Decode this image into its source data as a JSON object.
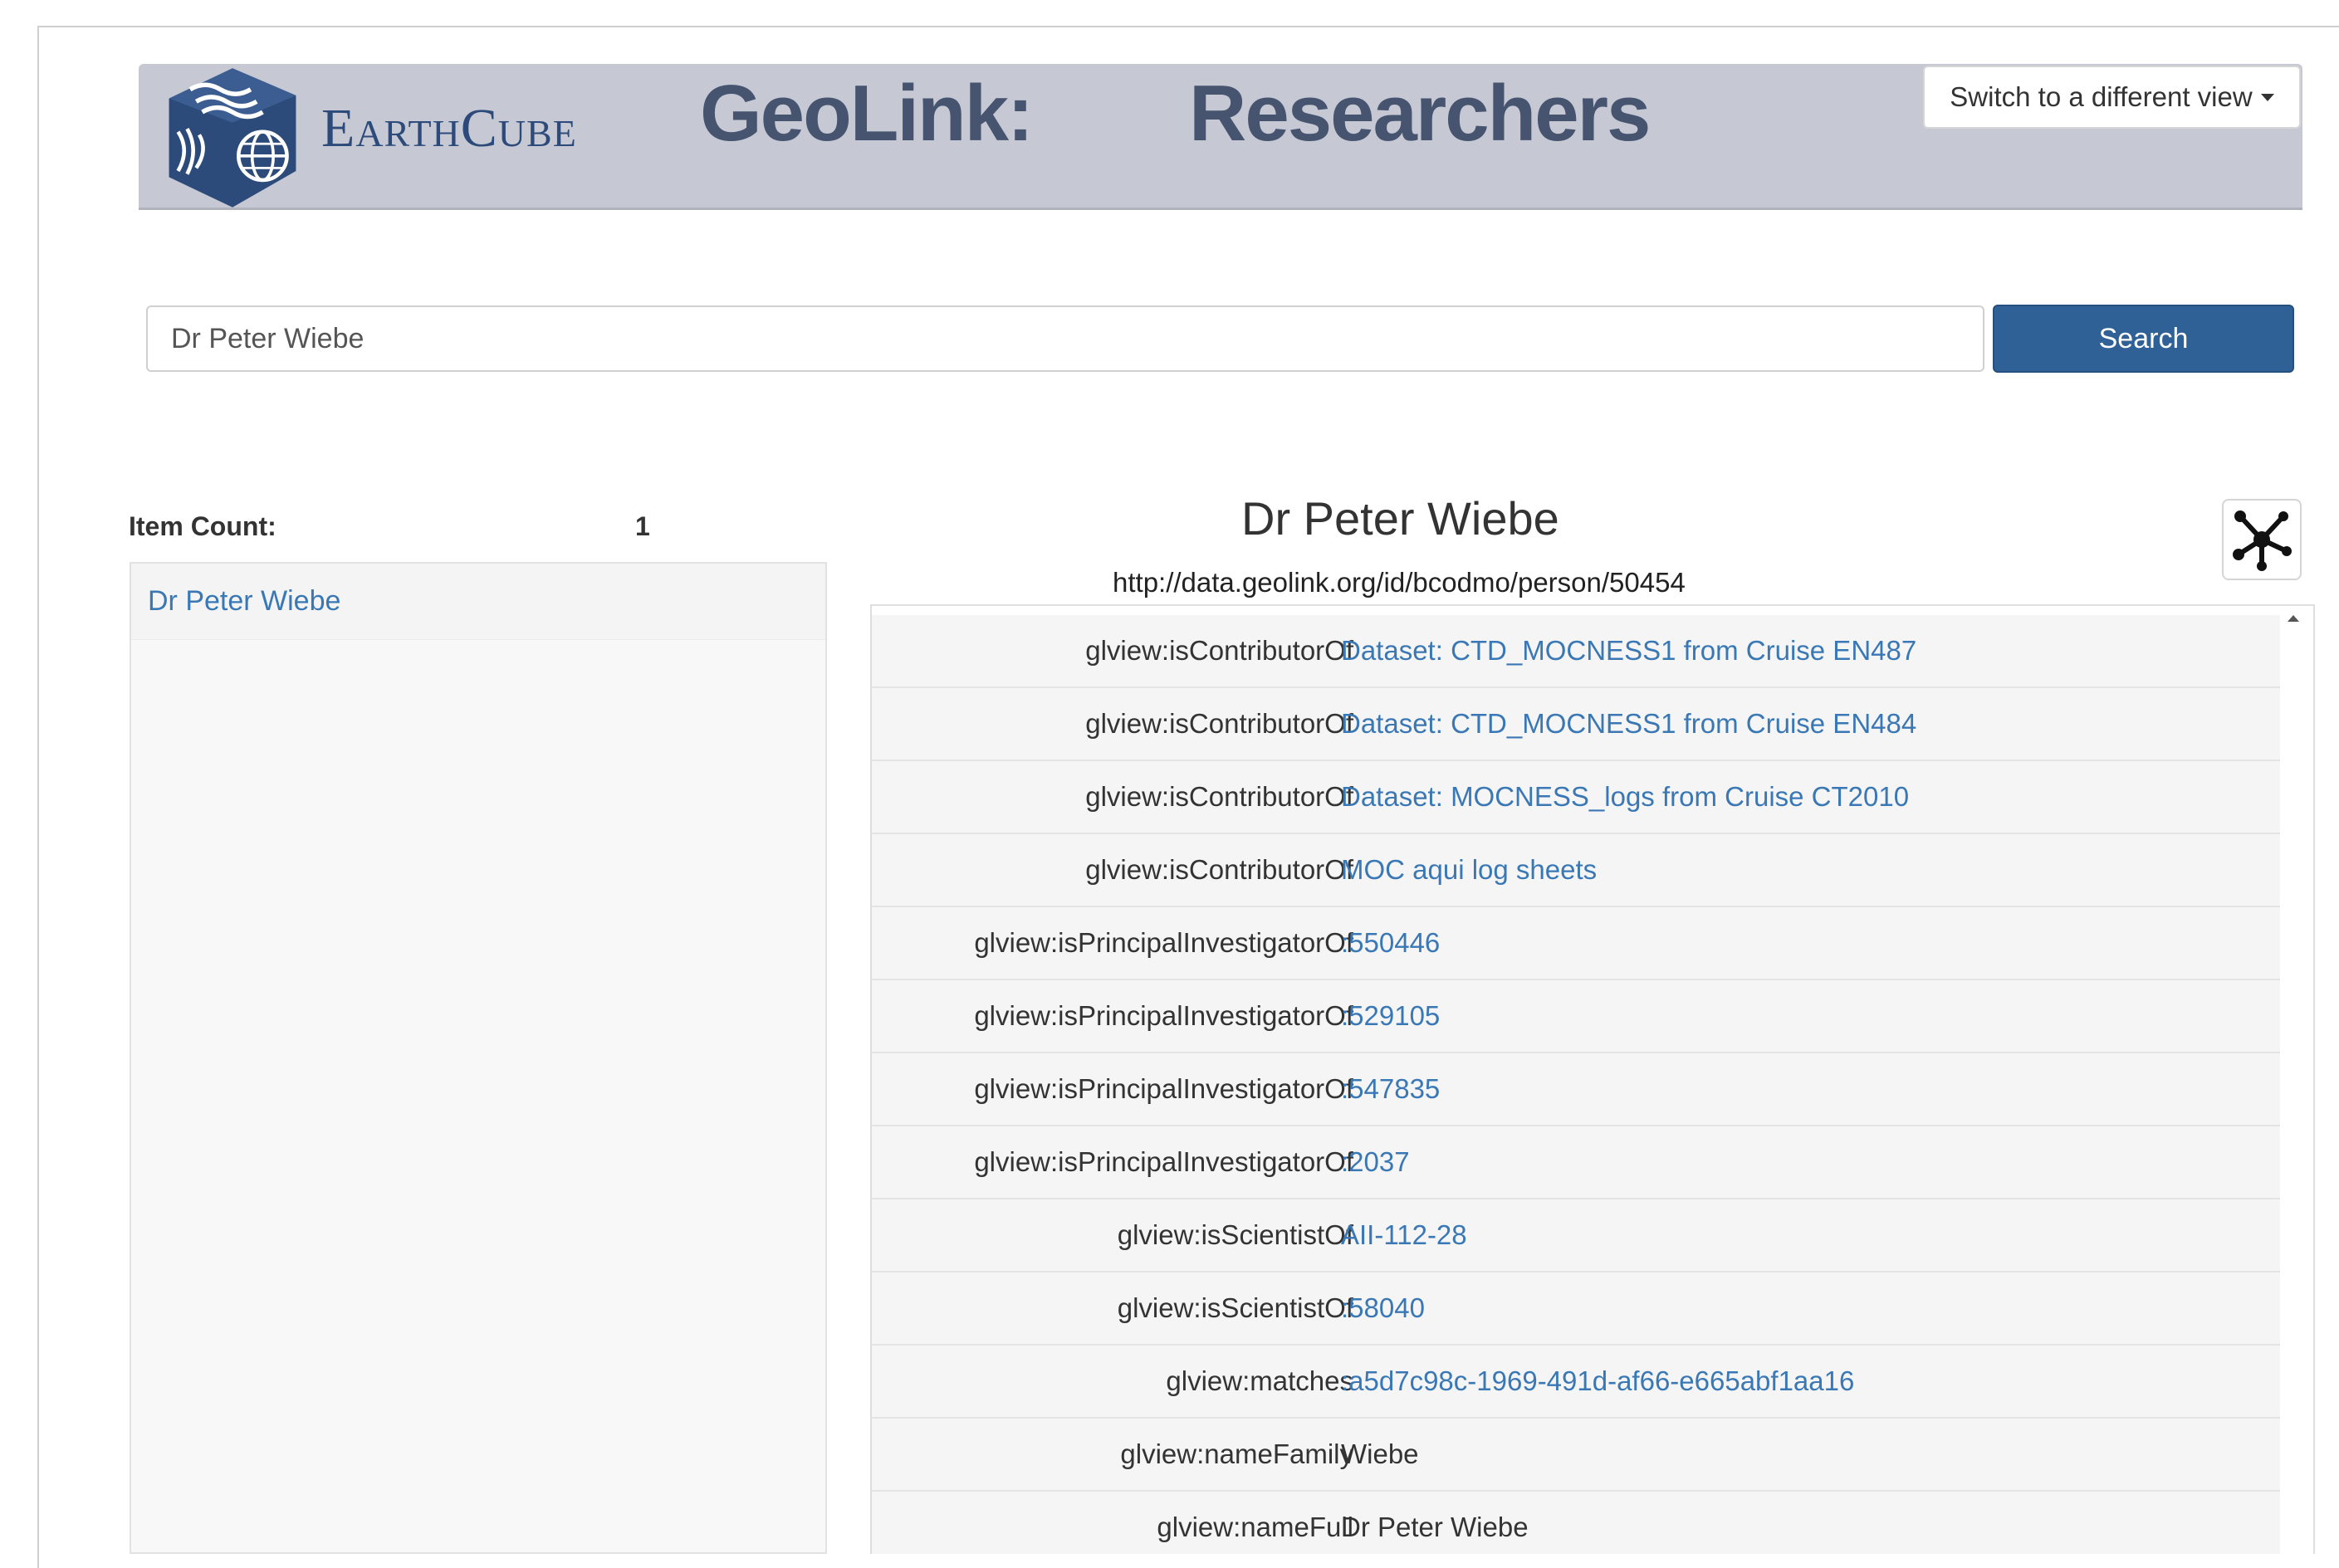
{
  "header": {
    "logo_text": "EarthCube",
    "title": "GeoLink:",
    "subtitle": "Researchers",
    "view_switch_label": "Switch to a different view"
  },
  "search": {
    "value": "Dr Peter Wiebe",
    "button_label": "Search"
  },
  "results": {
    "count_label": "Item Count:",
    "count_value": "1",
    "items": [
      "Dr Peter Wiebe"
    ]
  },
  "detail": {
    "name": "Dr Peter Wiebe",
    "uri": "http://data.geolink.org/id/bcodmo/person/50454",
    "properties": [
      {
        "predicate": "glview:isContributorOf",
        "object": "Dataset: CTD_MOCNESS1 from Cruise EN487",
        "link": true
      },
      {
        "predicate": "glview:isContributorOf",
        "object": "Dataset: CTD_MOCNESS1 from Cruise EN484",
        "link": true
      },
      {
        "predicate": "glview:isContributorOf",
        "object": "Dataset: MOCNESS_logs from Cruise CT2010",
        "link": true
      },
      {
        "predicate": "glview:isContributorOf",
        "object": "MOC aqui log sheets",
        "link": true
      },
      {
        "predicate": "glview:isPrincipalInvestigatorOf",
        "object": ":550446",
        "link": true
      },
      {
        "predicate": "glview:isPrincipalInvestigatorOf",
        "object": ":529105",
        "link": true
      },
      {
        "predicate": "glview:isPrincipalInvestigatorOf",
        "object": ":547835",
        "link": true
      },
      {
        "predicate": "glview:isPrincipalInvestigatorOf",
        "object": ":2037",
        "link": true
      },
      {
        "predicate": "glview:isScientistOf",
        "object": "AII-112-28",
        "link": true
      },
      {
        "predicate": "glview:isScientistOf",
        "object": ":58040",
        "link": true
      },
      {
        "predicate": "glview:matches",
        "object": ":a5d7c98c-1969-491d-af66-e665abf1aa16",
        "link": true
      },
      {
        "predicate": "glview:nameFamily",
        "object": "Wiebe",
        "link": false
      },
      {
        "predicate": "glview:nameFull",
        "object": "Dr Peter Wiebe",
        "link": false
      }
    ]
  },
  "colors": {
    "header_bg": "#c6c9d4",
    "brand_blue": "#2d4b7a",
    "title_gray": "#46546f",
    "link": "#3a78b5",
    "search_button": "#2f6197"
  },
  "icons": [
    "earthcube-logo-icon",
    "caret-down-icon",
    "network-graph-icon",
    "scroll-up-icon"
  ]
}
